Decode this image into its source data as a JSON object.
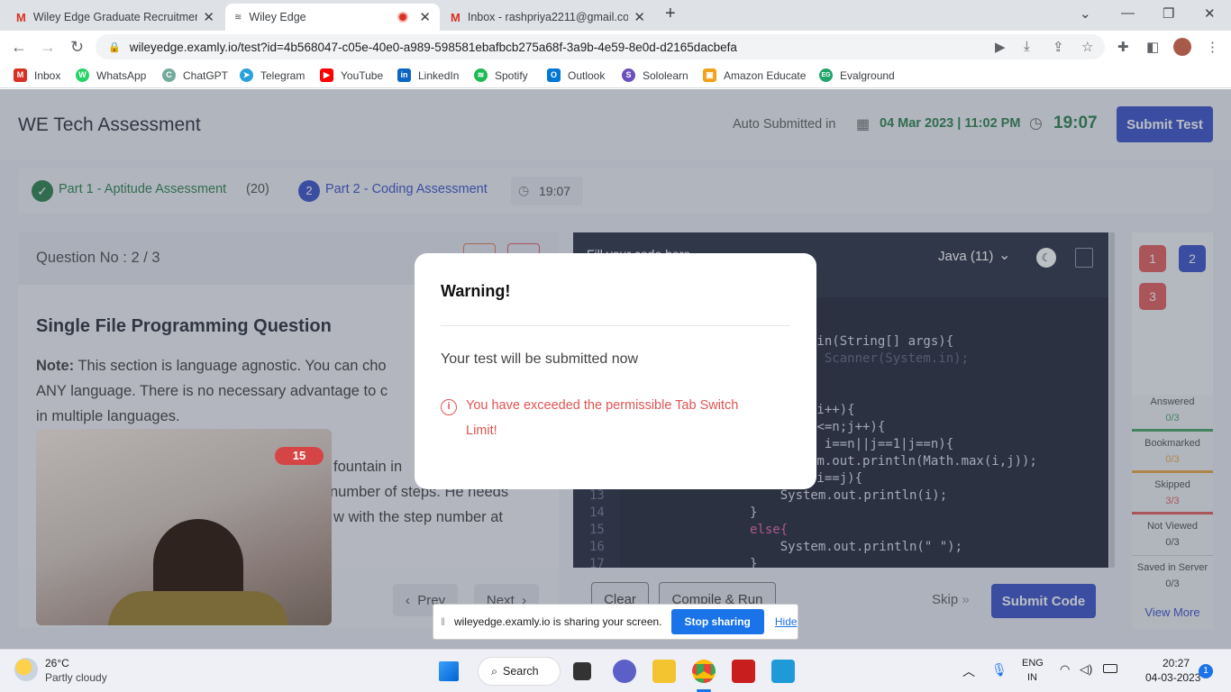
{
  "browser": {
    "tabs": [
      {
        "title": "Wiley Edge Graduate Recruitment",
        "icon": "gmail-icon"
      },
      {
        "title": "Wiley Edge",
        "icon": "wiley-icon",
        "active": true
      },
      {
        "title": "Inbox - rashpriya2211@gmail.com",
        "icon": "gmail-icon"
      }
    ],
    "url": "wileyedge.examly.io/test?id=4b568047-c05e-40e0-a989-598581ebafbcb275a68f-3a9b-4e59-8e0d-d2165dacbefa",
    "bookmarks": [
      {
        "label": "Inbox",
        "color": "#d93025",
        "glyph": "M"
      },
      {
        "label": "WhatsApp",
        "color": "#25d366",
        "glyph": "W"
      },
      {
        "label": "ChatGPT",
        "color": "#74aa9c",
        "glyph": "C"
      },
      {
        "label": "Telegram",
        "color": "#2aa1da",
        "glyph": "T"
      },
      {
        "label": "YouTube",
        "color": "#ff0000",
        "glyph": "▶"
      },
      {
        "label": "LinkedIn",
        "color": "#0a66c2",
        "glyph": "in"
      },
      {
        "label": "Spotify",
        "color": "#1db954",
        "glyph": "S"
      },
      {
        "label": "Outlook",
        "color": "#0078d4",
        "glyph": "O"
      },
      {
        "label": "Sololearn",
        "color": "#6b4fbb",
        "glyph": "S"
      },
      {
        "label": "Amazon Educate",
        "color": "#f0a21b",
        "glyph": "A"
      },
      {
        "label": "Evalground",
        "color": "#1fa46a",
        "glyph": "EG"
      }
    ]
  },
  "app": {
    "title": "WE Tech Assessment",
    "auto_submitted_label": "Auto Submitted in",
    "datetime": "04 Mar 2023 | 11:02 PM",
    "timer": "19:07",
    "submit_test": "Submit Test",
    "part1_label": "Part 1 - Aptitude Assessment",
    "part1_count": "(20)",
    "part2_num": "2",
    "part2_label": "Part 2 - Coding Assessment",
    "part2_timer": "19:07"
  },
  "question": {
    "number_label": "Question No : 2 / 3",
    "heading": "Single File Programming Question",
    "note_bold": "Note:",
    "note_text_1": " This section is language agnostic. You can cho",
    "note_text_2": "ANY language. There is no necessary advantage to c",
    "note_text_3": "in multiple languages.",
    "body_1": "fountain in",
    "body_2": "number of steps. He needs",
    "body_3": "w with the step number at",
    "prev": "Prev",
    "next": "Next"
  },
  "editor": {
    "header": "Fill your code here",
    "language": "Java (11)",
    "line_numbers": [
      "13",
      "14",
      "15",
      "16",
      "17"
    ],
    "code_lines": [
      "ain(String[] args){",
      "w Scanner(System.in);",
      "",
      ";i++){",
      "j<=n;j++){",
      "| i==n||j==1|j==n){",
      "em.out.println(Math.max(i,j));",
      "(i==j){",
      "    System.out.println(i);",
      "}",
      "else{",
      "    System.out.println(\" \");",
      "}"
    ],
    "clear": "Clear",
    "compile": "Compile & Run",
    "skip": "Skip",
    "submit_code": "Submit Code"
  },
  "sidebar": {
    "questions": [
      {
        "num": "1",
        "color": "#e05454"
      },
      {
        "num": "2",
        "color": "#2f48c5"
      },
      {
        "num": "3",
        "color": "#e05454"
      }
    ],
    "stats": [
      {
        "label": "Answered",
        "value": "0/3",
        "color": "#3aa05a"
      },
      {
        "label": "Bookmarked",
        "value": "0/3",
        "color": "#e8a23a"
      },
      {
        "label": "Skipped",
        "value": "3/3",
        "color": "#e05454"
      },
      {
        "label": "Not Viewed",
        "value": "0/3",
        "color": "#888888"
      },
      {
        "label": "Saved in Server",
        "value": "0/3",
        "color": "#888888"
      }
    ],
    "view_more": "View More"
  },
  "webcam": {
    "badge": "15"
  },
  "modal": {
    "title": "Warning!",
    "message": "Your test will be submitted now",
    "error_line1": "You have exceeded the permissible Tab Switch",
    "error_line2": "Limit!"
  },
  "share_bar": {
    "text": "wileyedge.examly.io is sharing your screen.",
    "stop": "Stop sharing",
    "hide": "Hide"
  },
  "taskbar": {
    "temp": "26°C",
    "weather": "Partly cloudy",
    "search": "Search",
    "lang1": "ENG",
    "lang2": "IN",
    "time": "20:27",
    "date": "04-03-2023",
    "notif": "1"
  }
}
